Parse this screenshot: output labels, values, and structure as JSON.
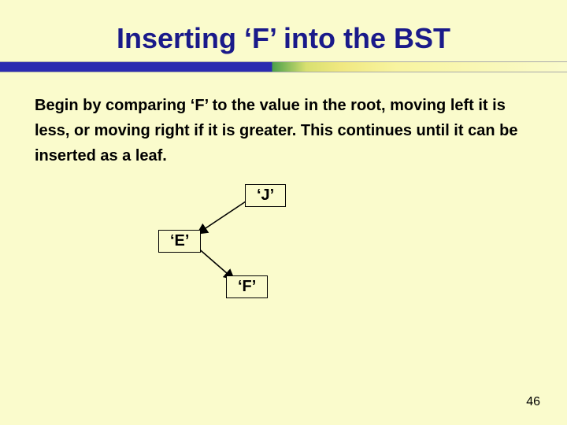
{
  "title": "Inserting ‘F’ into the BST",
  "body": "Begin by comparing ‘F’ to the value in the root, moving left it is less, or moving right if it is greater.  This continues until it can be inserted as a leaf.",
  "nodes": {
    "j": "‘J’",
    "e": "‘E’",
    "f": "‘F’"
  },
  "page_number": "46",
  "chart_data": {
    "type": "diagram",
    "structure": "binary-search-tree-insertion",
    "root": "J",
    "inserting": "F",
    "edges": [
      {
        "from": "J",
        "to": "E",
        "direction": "left"
      },
      {
        "from": "E",
        "to": "F",
        "direction": "right"
      }
    ],
    "nodes": [
      "J",
      "E",
      "F"
    ]
  }
}
